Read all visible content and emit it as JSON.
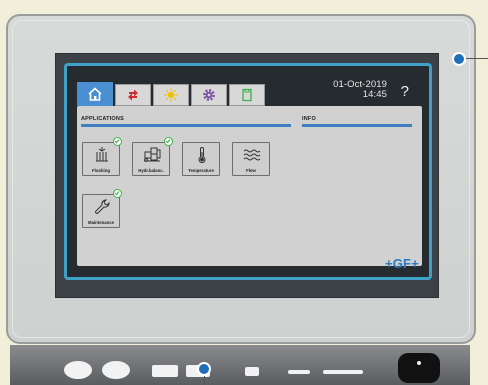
{
  "header": {
    "tabs": [
      {
        "icon": "home-icon",
        "color": "#4a8fd1",
        "active": true
      },
      {
        "icon": "pump-arrows-icon",
        "color": "#d12b2b",
        "active": false
      },
      {
        "icon": "sun-icon",
        "color": "#f2c200",
        "active": false
      },
      {
        "icon": "gear-icon",
        "color": "#7b4fa3",
        "active": false
      },
      {
        "icon": "document-icon",
        "color": "#3fb04a",
        "active": false
      }
    ],
    "date": "01-Oct-2019",
    "time": "14:45",
    "help": "?"
  },
  "applications": {
    "title": "APPLICATIONS",
    "items": [
      {
        "label": "Flushing",
        "icon": "flushing-icon",
        "checked": true
      },
      {
        "label": "Hydr.balanc.",
        "icon": "hydraulic-balance-icon",
        "checked": true
      },
      {
        "label": "Temperature",
        "icon": "thermometer-icon",
        "checked": false
      },
      {
        "label": "Flow",
        "icon": "flow-waves-icon",
        "checked": false
      },
      {
        "label": "Maintenance",
        "icon": "wrench-icon",
        "checked": true
      }
    ]
  },
  "info": {
    "title": "INFO"
  },
  "brand": {
    "logo": "+GF+",
    "color": "#2d78bf"
  },
  "accent": {
    "frame": "#3fa1c7",
    "check": "#3fb04a",
    "callout": "#1f6fb8"
  }
}
